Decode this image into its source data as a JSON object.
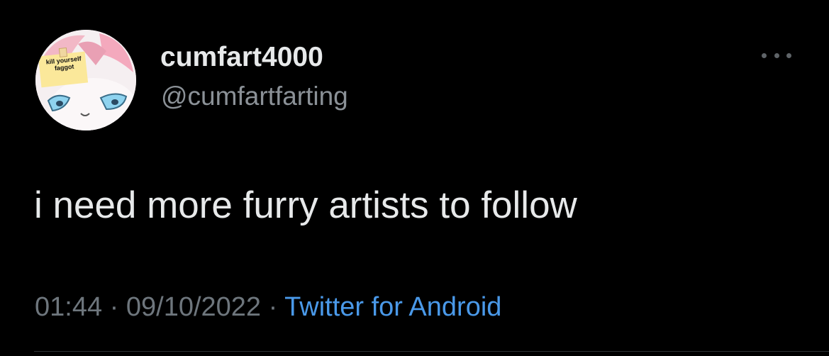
{
  "tweet": {
    "author": {
      "display_name": "cumfart4000",
      "handle": "@cumfartfarting",
      "avatar_note_line1": "kill yourself",
      "avatar_note_line2": "faggot"
    },
    "text": "i need more furry artists to follow",
    "time": "01:44",
    "separator": "·",
    "date": "09/10/2022",
    "source": "Twitter for Android",
    "more_icon": "more-horizontal-icon"
  },
  "colors": {
    "background": "#000000",
    "primary_text": "#e7e9ea",
    "secondary_text": "#6e767d",
    "link": "#4a99e9",
    "divider": "#2f3336"
  }
}
